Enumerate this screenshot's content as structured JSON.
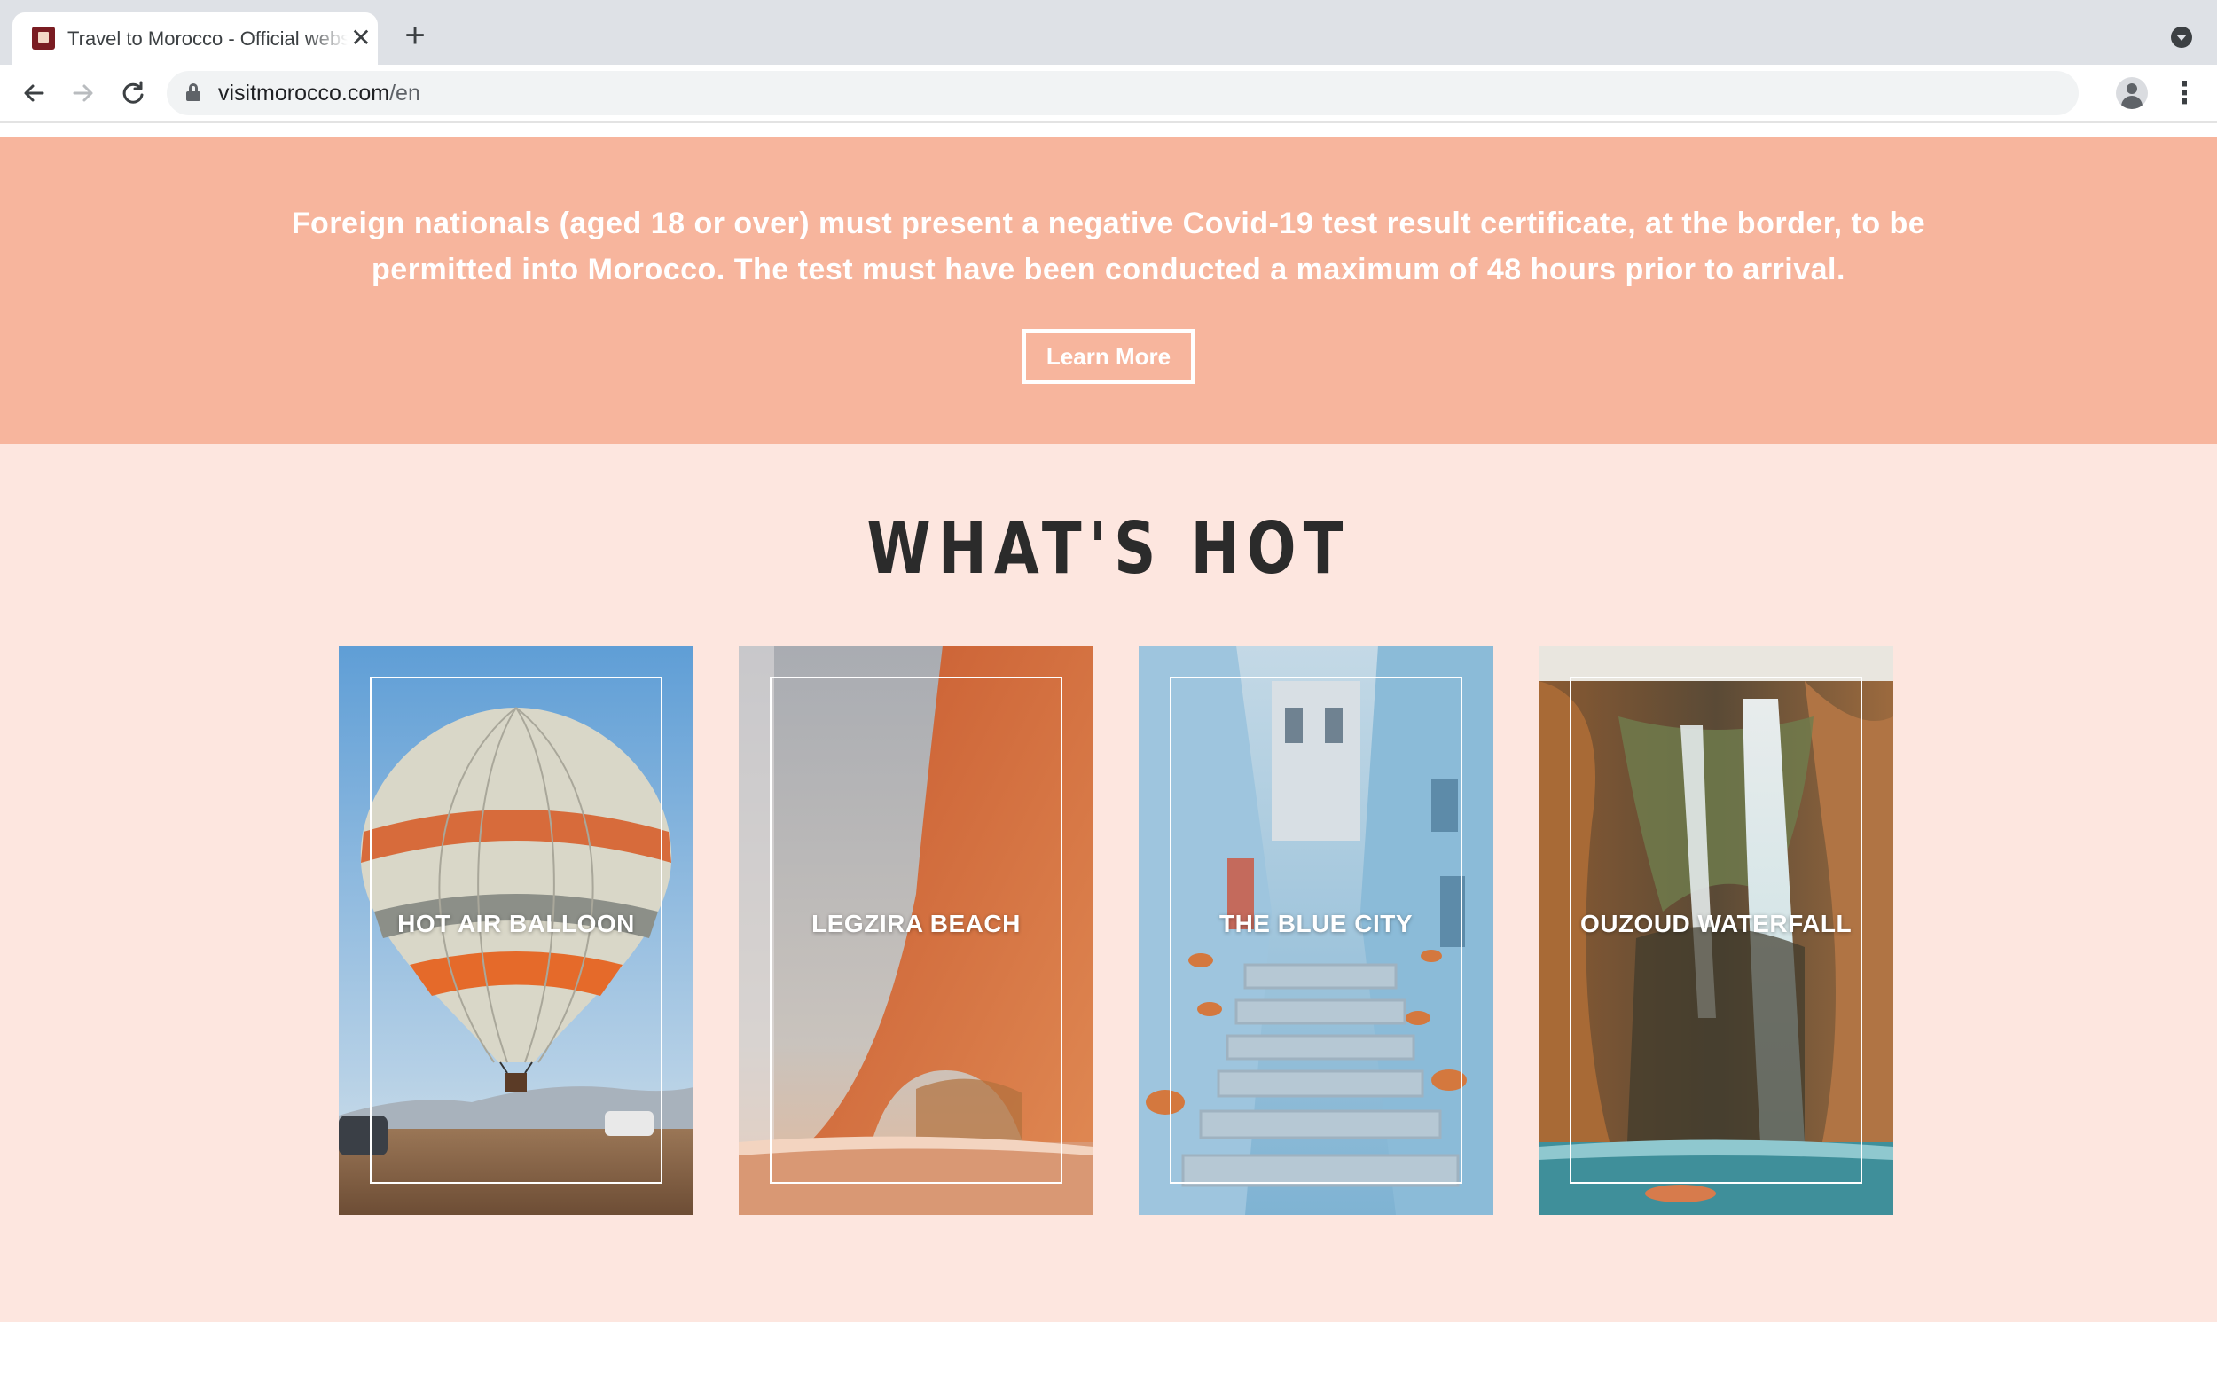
{
  "browser": {
    "tab_title": "Travel to Morocco - Official website",
    "new_tab_symbol": "+",
    "url_host": "visitmorocco.com",
    "url_path": "/en",
    "icons": {
      "back": "arrow-left-icon",
      "forward": "arrow-right-icon",
      "reload": "reload-icon",
      "lock": "lock-icon",
      "bookmark": "star-icon",
      "profile": "profile-icon",
      "menu": "kebab-menu-icon"
    }
  },
  "alert": {
    "message": "Foreign nationals (aged 18 or over) must present a negative Covid-19 test result certificate, at the border, to be permitted into Morocco. The test must have been conducted a maximum of 48 hours prior to arrival.",
    "button_label": "Learn More",
    "background_color": "#f7b59d"
  },
  "whats_hot": {
    "title": "WHAT'S HOT",
    "background_color": "#fde6df",
    "cards": [
      {
        "label": "HOT AIR BALLOON"
      },
      {
        "label": "LEGZIRA BEACH"
      },
      {
        "label": "THE BLUE CITY"
      },
      {
        "label": "OUZOUD WATERFALL"
      }
    ]
  }
}
